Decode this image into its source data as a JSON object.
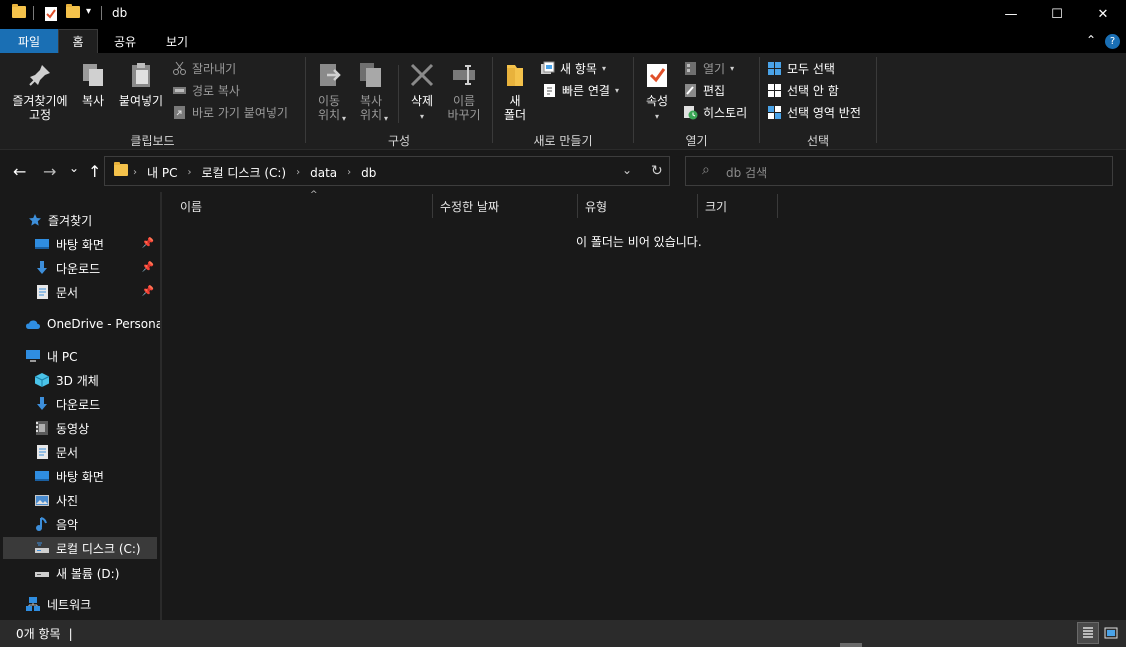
{
  "window": {
    "title": "db",
    "qa_caret": "▾",
    "minimize_glyph": "—",
    "maximize_glyph": "☐",
    "close_glyph": "✕"
  },
  "tabs": [
    {
      "label": "파일"
    },
    {
      "label": "홈"
    },
    {
      "label": "공유"
    },
    {
      "label": "보기"
    }
  ],
  "ribbon": {
    "collapse_glyph": "⌃",
    "help_glyph": "?",
    "clipboard": {
      "label": "클립보드",
      "pin_quick_access": "즐겨찾기에\n고정",
      "copy": "복사",
      "paste": "붙여넣기",
      "cut": "잘라내기",
      "copy_path": "경로 복사",
      "paste_shortcut": "바로 가기 붙여넣기"
    },
    "organize": {
      "label": "구성",
      "move_to": "이동\n위치",
      "copy_to": "복사\n위치",
      "delete": "삭제",
      "rename": "이름\n바꾸기"
    },
    "new": {
      "label": "새로 만들기",
      "new_folder": "새\n폴더",
      "new_item": "새 항목",
      "easy_access": "빠른 연결"
    },
    "open": {
      "label": "열기",
      "properties": "속성",
      "open": "열기",
      "edit": "편집",
      "history": "히스토리"
    },
    "select": {
      "label": "선택",
      "select_all": "모두 선택",
      "select_none": "선택 안 함",
      "invert_selection": "선택 영역 반전"
    }
  },
  "address": {
    "back_glyph": "←",
    "forward_glyph": "→",
    "recent_glyph": "⌄",
    "up_glyph": "↑",
    "crumbs": [
      "내 PC",
      "로컬 디스크 (C:)",
      "data",
      "db"
    ],
    "search_placeholder": "db 검색",
    "search_glyph": "⌕",
    "dropdown_glyph": "⌄",
    "refresh_glyph": "↻"
  },
  "nav": {
    "pin_glyph": "📌",
    "quick_access": "즐겨찾기",
    "qa_items": [
      {
        "label": "바탕 화면"
      },
      {
        "label": "다운로드"
      },
      {
        "label": "문서"
      }
    ],
    "onedrive": "OneDrive - Personal",
    "this_pc": "내 PC",
    "pc_items": [
      {
        "label": "3D 개체"
      },
      {
        "label": "다운로드"
      },
      {
        "label": "동영상"
      },
      {
        "label": "문서"
      },
      {
        "label": "바탕 화면"
      },
      {
        "label": "사진"
      },
      {
        "label": "음악"
      },
      {
        "label": "로컬 디스크 (C:)"
      },
      {
        "label": "새 볼륨 (D:)"
      }
    ],
    "network": "네트워크"
  },
  "columns": {
    "name": "이름",
    "modified": "수정한 날짜",
    "type": "유형",
    "size": "크기",
    "sort_glyph": "^"
  },
  "content": {
    "empty_message": "이 폴더는 비어 있습니다."
  },
  "status": {
    "item_count": "0개 항목"
  },
  "colors": {
    "accent": "#1a6fb4",
    "background": "#191919",
    "folder": "#f4c24b"
  }
}
